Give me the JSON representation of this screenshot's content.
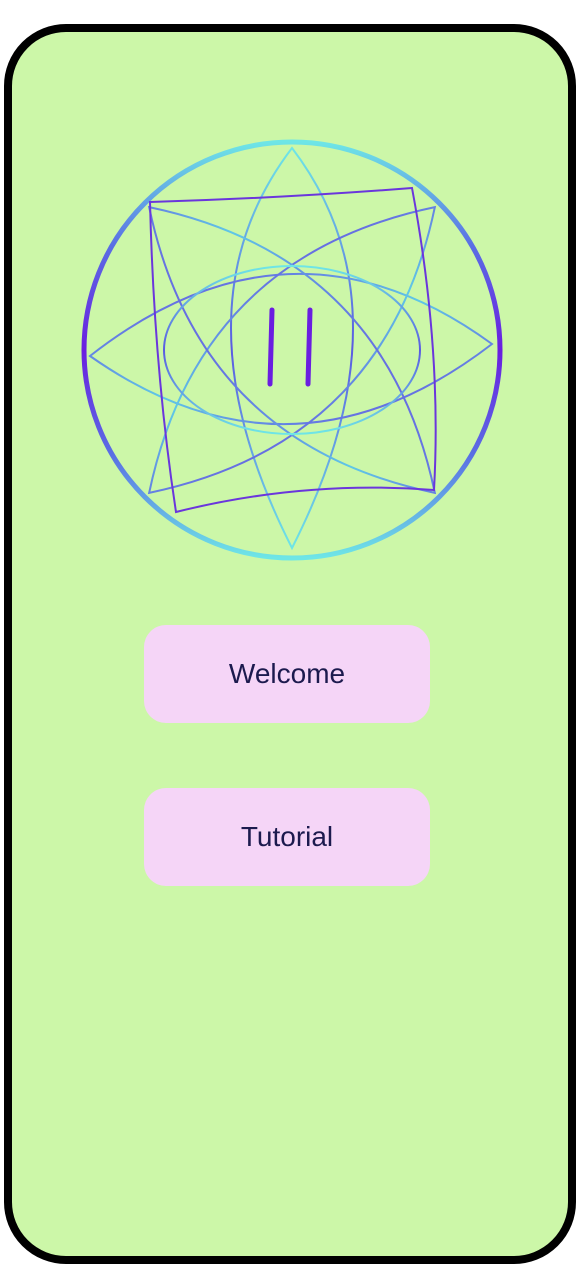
{
  "screen": {
    "background_color": "#ccf7a8",
    "frame_color": "#000000"
  },
  "player": {
    "icon": "pause-icon",
    "ring_gradient": [
      "#6a1ee0",
      "#6ee6e6"
    ],
    "button_color": "#f5d5f7"
  },
  "menu": {
    "welcome_label": "Welcome",
    "tutorial_label": "Tutorial"
  }
}
